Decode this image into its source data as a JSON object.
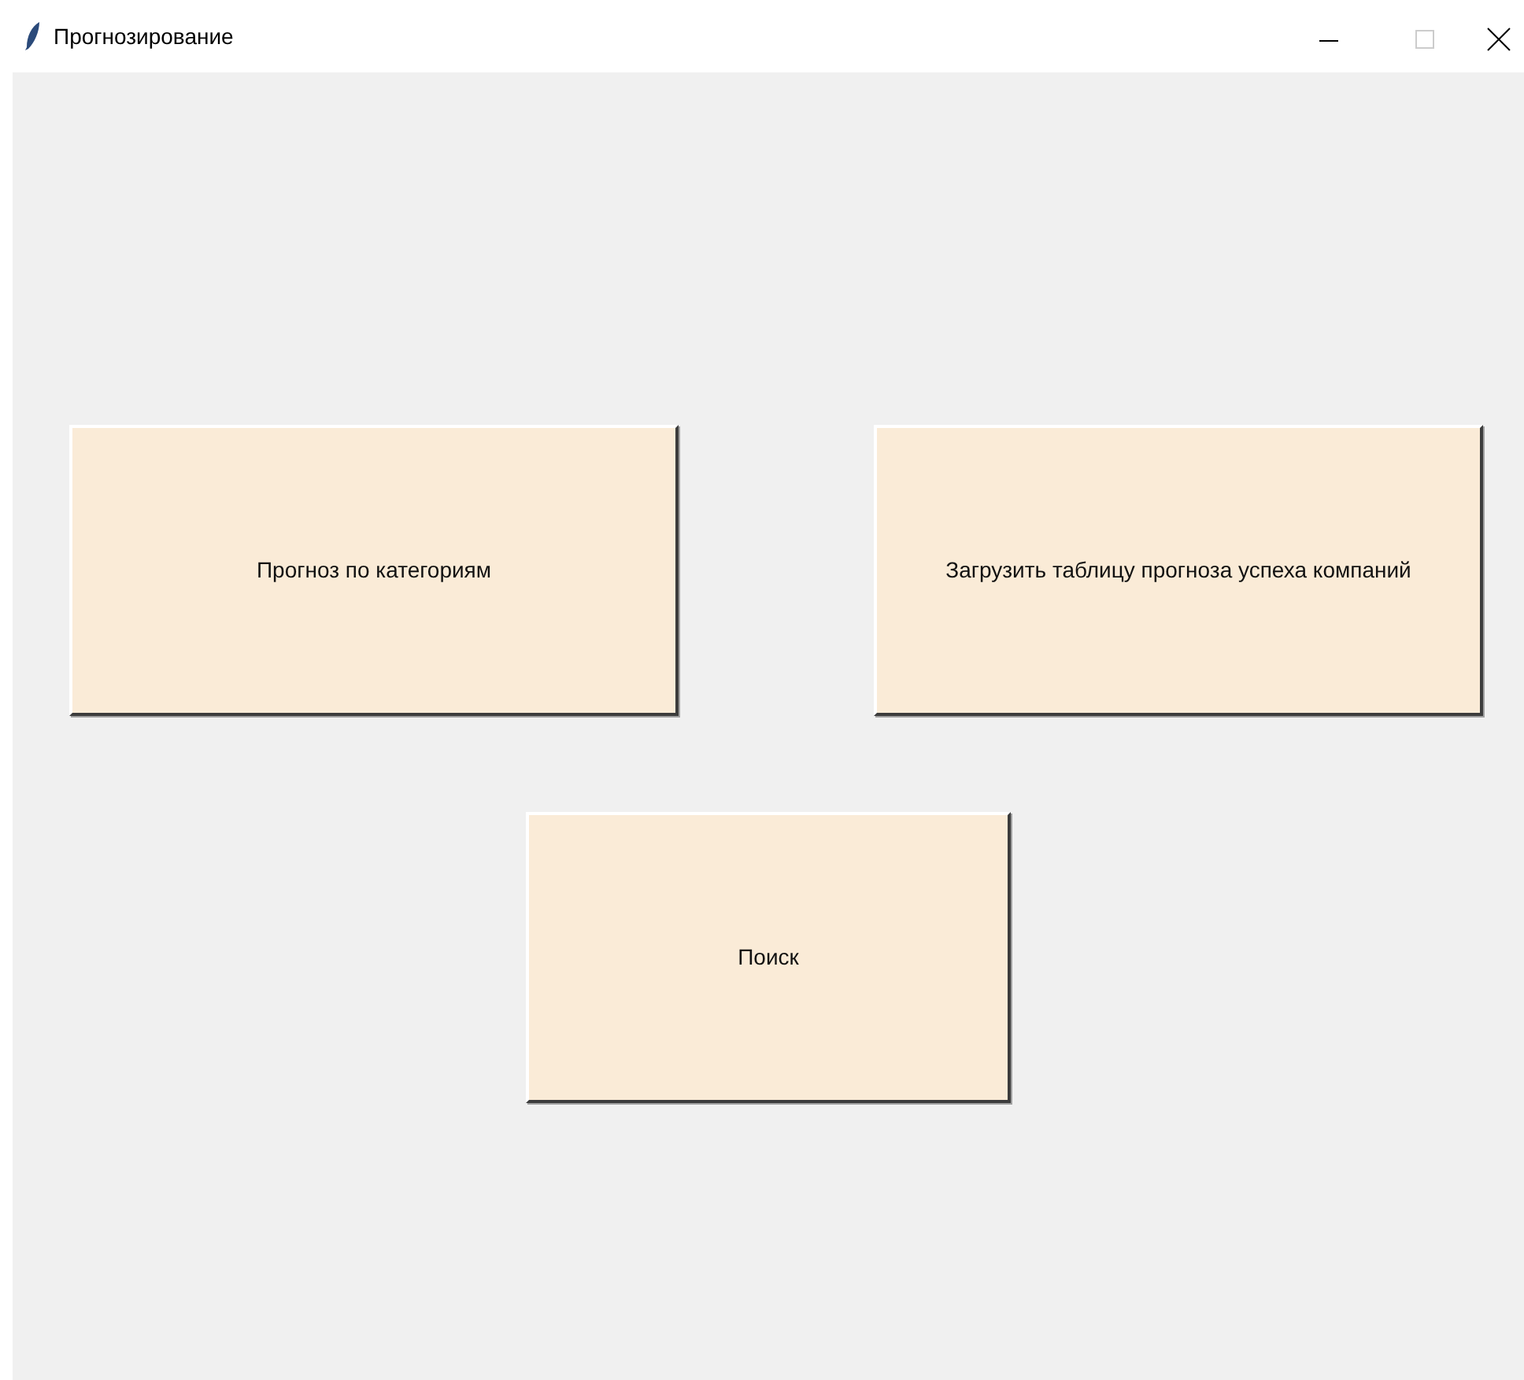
{
  "window": {
    "title": "Прогнозирование"
  },
  "buttons": [
    {
      "label": "Прогноз по категориям"
    },
    {
      "label": "Загрузить таблицу прогноза успеха компаний"
    },
    {
      "label": "Поиск"
    }
  ]
}
